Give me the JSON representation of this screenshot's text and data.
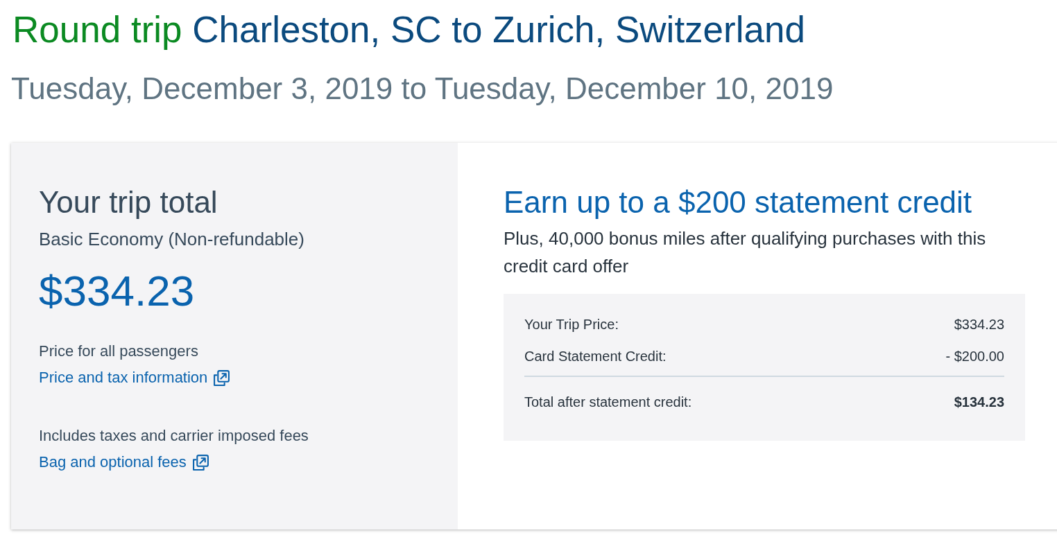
{
  "title": {
    "prefix": "Round trip",
    "route": "Charleston, SC to Zurich, Switzerland"
  },
  "dates": "Tuesday, December 3, 2019 to Tuesday, December 10, 2019",
  "trip_total": {
    "heading": "Your trip total",
    "fare_type": "Basic Economy (Non-refundable)",
    "price": "$334.23",
    "notes": [
      {
        "text": "Price for all passengers",
        "link": "Price and tax information"
      },
      {
        "text": "Includes taxes and carrier imposed fees",
        "link": "Bag and optional fees"
      }
    ]
  },
  "offer": {
    "heading": "Earn up to a $200 statement credit",
    "description": "Plus, 40,000 bonus miles after qualifying purchases with this credit card offer",
    "summary": [
      {
        "kind": "line",
        "label": "Your Trip Price:",
        "value": "$334.23"
      },
      {
        "kind": "line",
        "label": "Card Statement Credit:",
        "value": "- $200.00"
      },
      {
        "kind": "total",
        "label": "Total after statement credit:",
        "value": "$134.23"
      }
    ]
  }
}
